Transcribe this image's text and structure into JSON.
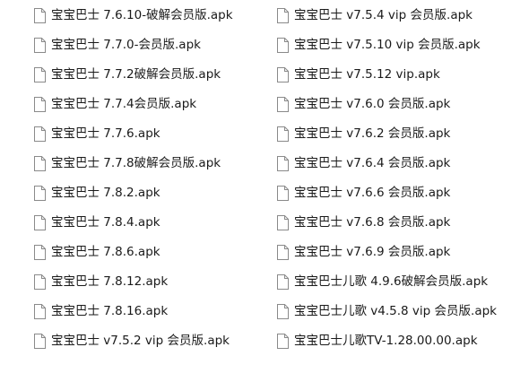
{
  "window": {
    "title": ""
  },
  "icon_name": "generic-file-icon",
  "files_left": [
    {
      "name": "宝宝巴士 7.6.10-破解会员版.apk"
    },
    {
      "name": "宝宝巴士 7.7.0-会员版.apk"
    },
    {
      "name": "宝宝巴士 7.7.2破解会员版.apk"
    },
    {
      "name": "宝宝巴士 7.7.4会员版.apk"
    },
    {
      "name": "宝宝巴士 7.7.6.apk"
    },
    {
      "name": "宝宝巴士 7.7.8破解会员版.apk"
    },
    {
      "name": "宝宝巴士 7.8.2.apk"
    },
    {
      "name": "宝宝巴士 7.8.4.apk"
    },
    {
      "name": "宝宝巴士 7.8.6.apk"
    },
    {
      "name": "宝宝巴士 7.8.12.apk"
    },
    {
      "name": "宝宝巴士 7.8.16.apk"
    },
    {
      "name": "宝宝巴士 v7.5.2  vip  会员版.apk"
    }
  ],
  "files_right": [
    {
      "name": "宝宝巴士 v7.5.4  vip  会员版.apk"
    },
    {
      "name": "宝宝巴士 v7.5.10  vip  会员版.apk"
    },
    {
      "name": "宝宝巴士 v7.5.12  vip.apk"
    },
    {
      "name": "宝宝巴士 v7.6.0  会员版.apk"
    },
    {
      "name": "宝宝巴士 v7.6.2  会员版.apk"
    },
    {
      "name": "宝宝巴士 v7.6.4  会员版.apk"
    },
    {
      "name": "宝宝巴士 v7.6.6  会员版.apk"
    },
    {
      "name": "宝宝巴士 v7.6.8  会员版.apk"
    },
    {
      "name": "宝宝巴士 v7.6.9  会员版.apk"
    },
    {
      "name": "宝宝巴士儿歌  4.9.6破解会员版.apk"
    },
    {
      "name": "宝宝巴士儿歌  v4.5.8  vip  会员版.apk"
    },
    {
      "name": "宝宝巴士儿歌TV-1.28.00.00.apk"
    }
  ],
  "colors": {
    "text": "#1a1a1a",
    "icon_stroke": "#8a8a8a",
    "background": "#ffffff"
  }
}
